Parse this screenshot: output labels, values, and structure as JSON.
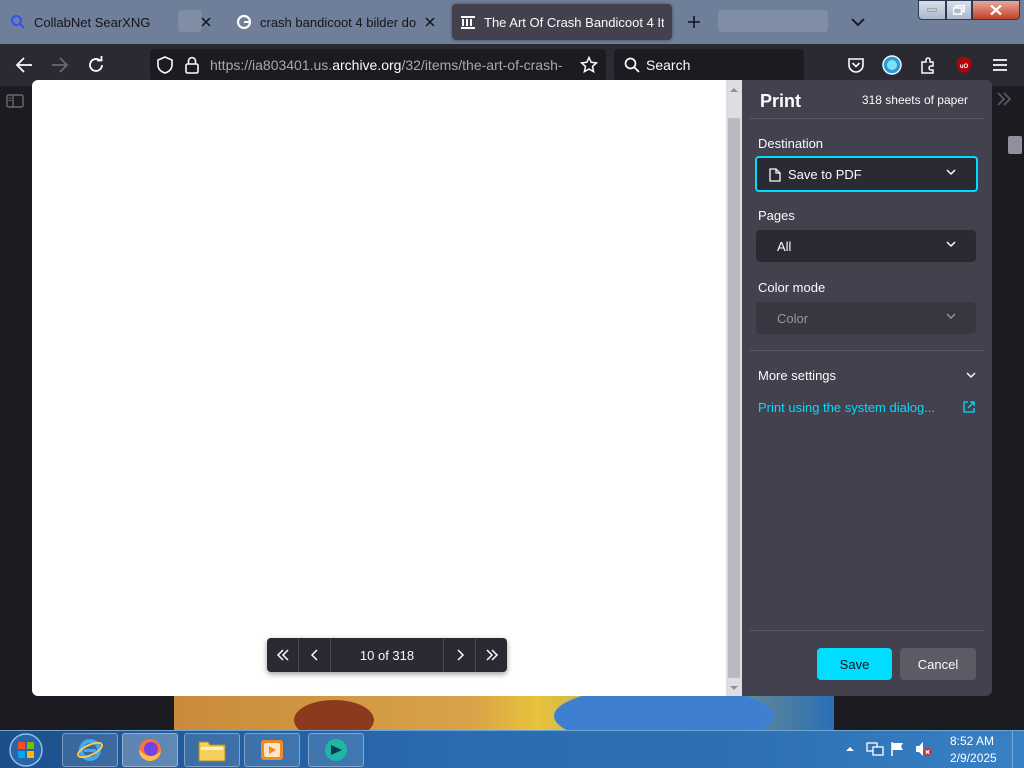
{
  "tabs": [
    {
      "title": "CollabNet SearXNG",
      "icon": "search-icon",
      "active": false
    },
    {
      "title": "crash bandicoot 4 bilder downl",
      "icon": "google-icon",
      "active": false
    },
    {
      "title": "The Art Of Crash Bandicoot 4 It",
      "icon": "archive-icon",
      "active": true
    }
  ],
  "nav": {
    "url_prefix": "https://ia803401.us.",
    "url_domain": "archive.org",
    "url_rest": "/32/items/the-art-of-crash-",
    "search_placeholder": "Search"
  },
  "print": {
    "title": "Print",
    "sheets": "318 sheets of paper",
    "destination_label": "Destination",
    "destination_value": "Save to PDF",
    "pages_label": "Pages",
    "pages_value": "All",
    "color_label": "Color mode",
    "color_value": "Color",
    "more_settings": "More settings",
    "system_dialog": "Print using the system dialog...",
    "save": "Save",
    "cancel": "Cancel"
  },
  "pager": {
    "label": "10 of 318"
  },
  "taskbar": {
    "time": "8:52 AM",
    "date": "2/9/2025"
  },
  "colors": {
    "accent": "#00ddff",
    "panel": "#42414d",
    "toolbar": "#2b2a33"
  }
}
